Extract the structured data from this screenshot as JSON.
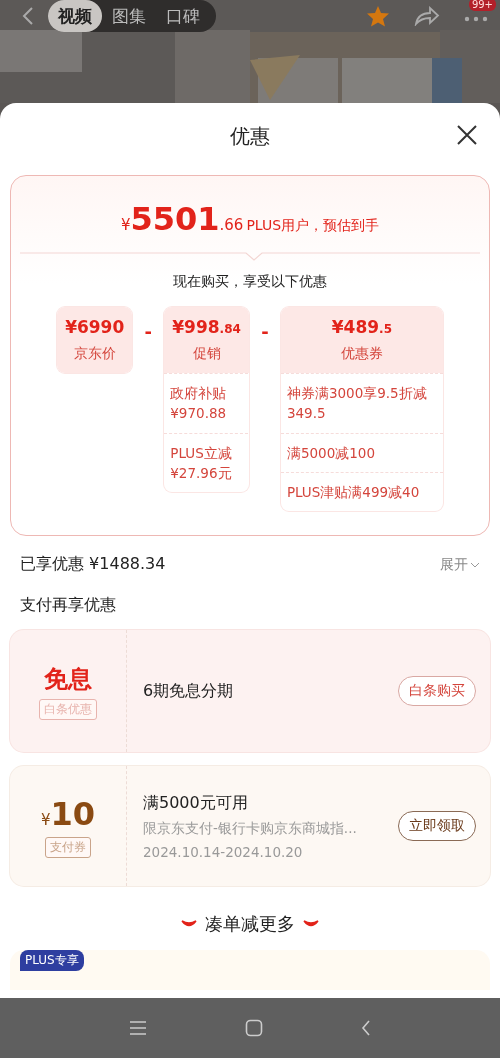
{
  "top_bar": {
    "tabs": [
      {
        "label": "视频",
        "selected": true
      },
      {
        "label": "图集",
        "selected": false
      },
      {
        "label": "口碑",
        "selected": false
      }
    ],
    "badge": "99+"
  },
  "sheet": {
    "title": "优惠"
  },
  "estimate": {
    "currency": "¥",
    "integer": "5501",
    "decimal": ".66",
    "note": "PLUS用户，预估到手"
  },
  "subtitle": "现在购买，享受以下优惠",
  "breakdown": [
    {
      "amount": "¥6990",
      "label": "京东价"
    },
    {
      "operator": "-",
      "amount": "¥998",
      "decimal": ".84",
      "label": "促销",
      "details": [
        "政府补贴\n¥970.88",
        "PLUS立减\n¥27.96元"
      ]
    },
    {
      "operator": "-",
      "amount": "¥489",
      "decimal": ".5",
      "label": "优惠券",
      "details": [
        "神券满3000享9.5折减349.5",
        "满5000减100",
        "PLUS津贴满499减40"
      ]
    }
  ],
  "saved": {
    "label": "已享优惠 ¥1488.34",
    "toggle": "展开"
  },
  "pay_title": "支付再享优惠",
  "pay_offers": [
    {
      "kind": "interest_free",
      "headline": "免息",
      "tag": "白条优惠",
      "title": "6期免息分期",
      "action": "白条购买"
    },
    {
      "kind": "coupon",
      "currency": "¥",
      "amount": "10",
      "tag": "支付券",
      "title": "满5000元可用",
      "description": "限京东支付-银行卡购京东商城指...",
      "dates": "2024.10.14-2024.10.20",
      "action": "立即领取"
    }
  ],
  "more": "凑单减更多",
  "plus_badge": "PLUS专享"
}
